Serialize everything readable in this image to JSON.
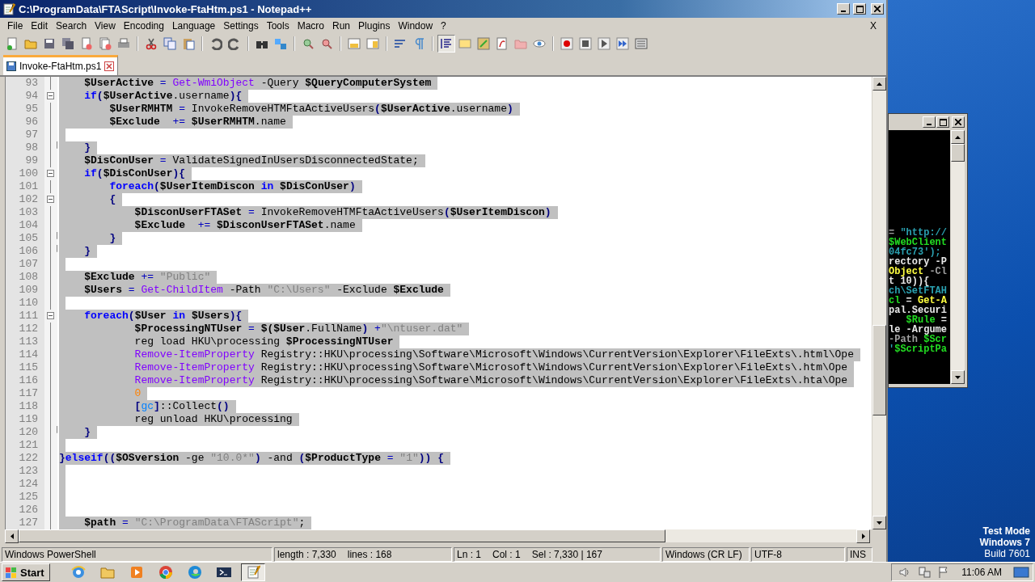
{
  "window": {
    "title": "C:\\ProgramData\\FTAScript\\Invoke-FtaHtm.ps1 - Notepad++",
    "menu": [
      "File",
      "Edit",
      "Search",
      "View",
      "Encoding",
      "Language",
      "Settings",
      "Tools",
      "Macro",
      "Run",
      "Plugins",
      "Window",
      "?"
    ],
    "close_document": "X"
  },
  "tabs": [
    {
      "label": "Invoke-FtaHtm.ps1",
      "selected": true
    }
  ],
  "editor": {
    "lines": [
      {
        "number": "93",
        "fold_open": false,
        "fold_close": false,
        "selected": true,
        "tokens": [
          {
            "kind": "var",
            "text": "    $UserActive"
          },
          {
            "kind": "op",
            "text": " = "
          },
          {
            "kind": "cmd",
            "text": "Get-WmiObject"
          },
          {
            "kind": "txt",
            "text": " -Query "
          },
          {
            "kind": "var",
            "text": "$QueryComputerSystem"
          }
        ]
      },
      {
        "number": "94",
        "fold_open": true,
        "fold_close": false,
        "selected": true,
        "tokens": [
          {
            "kind": "kw",
            "text": "    if"
          },
          {
            "kind": "brace",
            "text": "("
          },
          {
            "kind": "var",
            "text": "$UserActive"
          },
          {
            "kind": "txt",
            "text": ".username"
          },
          {
            "kind": "brace",
            "text": "){"
          }
        ]
      },
      {
        "number": "95",
        "fold_open": false,
        "fold_close": false,
        "selected": true,
        "tokens": [
          {
            "kind": "var",
            "text": "        $UserRMHTM"
          },
          {
            "kind": "op",
            "text": " = "
          },
          {
            "kind": "txt",
            "text": "InvokeRemoveHTMFtaActiveUsers"
          },
          {
            "kind": "brace",
            "text": "("
          },
          {
            "kind": "var",
            "text": "$UserActive"
          },
          {
            "kind": "txt",
            "text": ".username"
          },
          {
            "kind": "brace",
            "text": ")"
          }
        ]
      },
      {
        "number": "96",
        "fold_open": false,
        "fold_close": false,
        "selected": true,
        "tokens": [
          {
            "kind": "var",
            "text": "        $Exclude"
          },
          {
            "kind": "op",
            "text": "  += "
          },
          {
            "kind": "var",
            "text": "$UserRMHTM"
          },
          {
            "kind": "txt",
            "text": ".name"
          }
        ]
      },
      {
        "number": "97",
        "fold_open": false,
        "fold_close": false,
        "selected": true
      },
      {
        "number": "98",
        "fold_open": false,
        "fold_close": true,
        "selected": true,
        "tokens": [
          {
            "kind": "brace",
            "text": "    }"
          }
        ]
      },
      {
        "number": "99",
        "fold_open": false,
        "fold_close": false,
        "selected": true,
        "tokens": [
          {
            "kind": "var",
            "text": "    $DisConUser"
          },
          {
            "kind": "op",
            "text": " = "
          },
          {
            "kind": "txt",
            "text": "ValidateSignedInUsersDisconnectedState;"
          }
        ]
      },
      {
        "number": "100",
        "fold_open": true,
        "fold_close": false,
        "selected": true,
        "tokens": [
          {
            "kind": "kw",
            "text": "    if"
          },
          {
            "kind": "brace",
            "text": "("
          },
          {
            "kind": "var",
            "text": "$DisConUser"
          },
          {
            "kind": "brace",
            "text": "){"
          }
        ]
      },
      {
        "number": "101",
        "fold_open": false,
        "fold_close": false,
        "selected": true,
        "tokens": [
          {
            "kind": "kw",
            "text": "        foreach"
          },
          {
            "kind": "brace",
            "text": "("
          },
          {
            "kind": "var",
            "text": "$UserItemDiscon"
          },
          {
            "kind": "kw",
            "text": " in "
          },
          {
            "kind": "var",
            "text": "$DisConUser"
          },
          {
            "kind": "brace",
            "text": ")"
          }
        ]
      },
      {
        "number": "102",
        "fold_open": true,
        "fold_close": false,
        "selected": true,
        "tokens": [
          {
            "kind": "brace",
            "text": "        {"
          }
        ]
      },
      {
        "number": "103",
        "fold_open": false,
        "fold_close": false,
        "selected": true,
        "tokens": [
          {
            "kind": "var",
            "text": "            $DisconUserFTASet"
          },
          {
            "kind": "op",
            "text": " = "
          },
          {
            "kind": "txt",
            "text": "InvokeRemoveHTMFtaActiveUsers"
          },
          {
            "kind": "brace",
            "text": "("
          },
          {
            "kind": "var",
            "text": "$UserItemDiscon"
          },
          {
            "kind": "brace",
            "text": ")"
          }
        ]
      },
      {
        "number": "104",
        "fold_open": false,
        "fold_close": false,
        "selected": true,
        "tokens": [
          {
            "kind": "var",
            "text": "            $Exclude"
          },
          {
            "kind": "op",
            "text": "  += "
          },
          {
            "kind": "var",
            "text": "$DisconUserFTASet"
          },
          {
            "kind": "txt",
            "text": ".name"
          }
        ]
      },
      {
        "number": "105",
        "fold_open": false,
        "fold_close": true,
        "selected": true,
        "tokens": [
          {
            "kind": "brace",
            "text": "        }"
          }
        ]
      },
      {
        "number": "106",
        "fold_open": false,
        "fold_close": true,
        "selected": true,
        "tokens": [
          {
            "kind": "brace",
            "text": "    }"
          }
        ]
      },
      {
        "number": "107",
        "fold_open": false,
        "fold_close": false,
        "selected": true
      },
      {
        "number": "108",
        "fold_open": false,
        "fold_close": false,
        "selected": true,
        "tokens": [
          {
            "kind": "var",
            "text": "    $Exclude"
          },
          {
            "kind": "op",
            "text": " += "
          },
          {
            "kind": "str",
            "text": "\"Public\""
          }
        ]
      },
      {
        "number": "109",
        "fold_open": false,
        "fold_close": false,
        "selected": true,
        "tokens": [
          {
            "kind": "var",
            "text": "    $Users"
          },
          {
            "kind": "op",
            "text": " = "
          },
          {
            "kind": "cmd",
            "text": "Get-ChildItem"
          },
          {
            "kind": "txt",
            "text": " -Path "
          },
          {
            "kind": "str",
            "text": "\"C:\\Users\""
          },
          {
            "kind": "txt",
            "text": " -Exclude "
          },
          {
            "kind": "var",
            "text": "$Exclude"
          }
        ]
      },
      {
        "number": "110",
        "fold_open": false,
        "fold_close": false,
        "selected": true
      },
      {
        "number": "111",
        "fold_open": true,
        "fold_close": false,
        "selected": true,
        "tokens": [
          {
            "kind": "kw",
            "text": "    foreach"
          },
          {
            "kind": "brace",
            "text": "("
          },
          {
            "kind": "var",
            "text": "$User"
          },
          {
            "kind": "kw",
            "text": " in "
          },
          {
            "kind": "var",
            "text": "$Users"
          },
          {
            "kind": "brace",
            "text": "){"
          }
        ]
      },
      {
        "number": "112",
        "fold_open": false,
        "fold_close": false,
        "selected": true,
        "tokens": [
          {
            "kind": "var",
            "text": "            $ProcessingNTUser"
          },
          {
            "kind": "op",
            "text": " = "
          },
          {
            "kind": "var",
            "text": "$("
          },
          {
            "kind": "var",
            "text": "$User"
          },
          {
            "kind": "txt",
            "text": ".FullName"
          },
          {
            "kind": "brace",
            "text": ")"
          },
          {
            "kind": "op",
            "text": " +"
          },
          {
            "kind": "str",
            "text": "\"\\ntuser.dat\""
          }
        ]
      },
      {
        "number": "113",
        "fold_open": false,
        "fold_close": false,
        "selected": true,
        "tokens": [
          {
            "kind": "txt",
            "text": "            reg load HKU\\processing "
          },
          {
            "kind": "var",
            "text": "$ProcessingNTUser"
          }
        ]
      },
      {
        "number": "114",
        "fold_open": false,
        "fold_close": false,
        "selected": true,
        "tokens": [
          {
            "kind": "cmd",
            "text": "            Remove-ItemProperty"
          },
          {
            "kind": "txt",
            "text": " Registry::HKU\\processing\\Software\\Microsoft\\Windows\\CurrentVersion\\Explorer\\FileExts\\.html\\Ope"
          }
        ]
      },
      {
        "number": "115",
        "fold_open": false,
        "fold_close": false,
        "selected": true,
        "tokens": [
          {
            "kind": "cmd",
            "text": "            Remove-ItemProperty"
          },
          {
            "kind": "txt",
            "text": " Registry::HKU\\processing\\Software\\Microsoft\\Windows\\CurrentVersion\\Explorer\\FileExts\\.htm\\Ope"
          }
        ]
      },
      {
        "number": "116",
        "fold_open": false,
        "fold_close": false,
        "selected": true,
        "tokens": [
          {
            "kind": "cmd",
            "text": "            Remove-ItemProperty"
          },
          {
            "kind": "txt",
            "text": " Registry::HKU\\processing\\Software\\Microsoft\\Windows\\CurrentVersion\\Explorer\\FileExts\\.hta\\Ope"
          }
        ]
      },
      {
        "number": "117",
        "fold_open": false,
        "fold_close": false,
        "selected": true,
        "tokens": [
          {
            "kind": "num",
            "text": "            0"
          }
        ]
      },
      {
        "number": "118",
        "fold_open": false,
        "fold_close": false,
        "selected": true,
        "tokens": [
          {
            "kind": "brace",
            "text": "            ["
          },
          {
            "kind": "type",
            "text": "gc"
          },
          {
            "kind": "brace",
            "text": "]"
          },
          {
            "kind": "txt",
            "text": "::Collect"
          },
          {
            "kind": "brace",
            "text": "()"
          }
        ]
      },
      {
        "number": "119",
        "fold_open": false,
        "fold_close": false,
        "selected": true,
        "tokens": [
          {
            "kind": "txt",
            "text": "            reg unload HKU\\processing"
          }
        ]
      },
      {
        "number": "120",
        "fold_open": false,
        "fold_close": true,
        "selected": true,
        "tokens": [
          {
            "kind": "brace",
            "text": "    }"
          }
        ]
      },
      {
        "number": "121",
        "fold_open": false,
        "fold_close": false,
        "selected": true
      },
      {
        "number": "122",
        "fold_open": false,
        "fold_close": false,
        "selected": true,
        "tokens": [
          {
            "kind": "brace",
            "text": "}"
          },
          {
            "kind": "kw",
            "text": "elseif"
          },
          {
            "kind": "brace",
            "text": "(("
          },
          {
            "kind": "var",
            "text": "$OSversion"
          },
          {
            "kind": "txt",
            "text": " -ge "
          },
          {
            "kind": "str",
            "text": "\"10.0*\""
          },
          {
            "kind": "brace",
            "text": ")"
          },
          {
            "kind": "txt",
            "text": " -and "
          },
          {
            "kind": "brace",
            "text": "("
          },
          {
            "kind": "var",
            "text": "$ProductType"
          },
          {
            "kind": "op",
            "text": " = "
          },
          {
            "kind": "str",
            "text": "\"1\""
          },
          {
            "kind": "brace",
            "text": ")) {"
          }
        ]
      },
      {
        "number": "123",
        "fold_open": false,
        "fold_close": false,
        "selected": true
      },
      {
        "number": "124",
        "fold_open": false,
        "fold_close": false,
        "selected": true
      },
      {
        "number": "125",
        "fold_open": false,
        "fold_close": false,
        "selected": true
      },
      {
        "number": "126",
        "fold_open": false,
        "fold_close": false,
        "selected": true
      },
      {
        "number": "127",
        "fold_open": false,
        "fold_close": false,
        "selected": true,
        "tokens": [
          {
            "kind": "var",
            "text": "    $path"
          },
          {
            "kind": "op",
            "text": " = "
          },
          {
            "kind": "str",
            "text": "\"C:\\ProgramData\\FTAScript\""
          },
          {
            "kind": "txt",
            "text": ";"
          }
        ]
      }
    ]
  },
  "status_bar": [
    {
      "items": [
        "Windows PowerShell"
      ]
    },
    {
      "items": [
        "length : 7,330",
        "lines : 168"
      ]
    },
    {
      "items": [
        "Ln : 1",
        "Col : 1",
        "Sel : 7,330 | 167"
      ]
    },
    {
      "items": [
        "Windows (CR LF)"
      ]
    },
    {
      "items": [
        "UTF-8"
      ]
    },
    {
      "items": [
        "INS"
      ]
    }
  ],
  "console": {
    "lines": [
      {
        "tokens": [
          {
            "kind": "op",
            "text": "= "
          },
          {
            "kind": "str",
            "text": "\"http://"
          }
        ]
      },
      {
        "tokens": [
          {
            "kind": "var",
            "text": "$WebClient"
          }
        ]
      },
      {
        "tokens": [
          {
            "kind": "str",
            "text": "04fc73');"
          }
        ]
      },
      {
        "tokens": [
          {
            "kind": "txt",
            "text": "rectory -P"
          }
        ]
      },
      {
        "tokens": [
          {
            "kind": "cmd",
            "text": "Object"
          },
          {
            "kind": "op",
            "text": " -Cl"
          }
        ]
      },
      {
        "tokens": [
          {
            "kind": "txt",
            "text": "t 10)){"
          }
        ]
      },
      {
        "tokens": [
          {
            "kind": "str",
            "text": "ch\\SetFTAH"
          }
        ]
      },
      {
        "tokens": [
          {
            "kind": "var",
            "text": "cl"
          },
          {
            "kind": "txt",
            "text": " = "
          },
          {
            "kind": "cmd",
            "text": "Get-A"
          }
        ]
      },
      {
        "tokens": [
          {
            "kind": "txt",
            "text": "pal.Securi"
          }
        ]
      },
      {
        "tokens": [
          {
            "kind": "var",
            "text": "   $Rule"
          },
          {
            "kind": "txt",
            "text": " ="
          }
        ]
      },
      {
        "tokens": [
          {
            "kind": "txt",
            "text": "le -Argume"
          }
        ]
      },
      {
        "tokens": [
          {
            "kind": "op",
            "text": "-Path "
          },
          {
            "kind": "var",
            "text": "$Scr"
          }
        ]
      },
      {
        "tokens": [
          {
            "kind": "str",
            "text": "'"
          },
          {
            "kind": "var",
            "text": "$ScriptPa"
          }
        ]
      }
    ]
  },
  "desktop": {
    "notice": [
      "Test Mode",
      "Windows 7",
      "Build 7601"
    ]
  },
  "taskbar": {
    "start": "Start",
    "apps": [
      {
        "kind": "ie",
        "selected": false
      },
      {
        "kind": "explorer",
        "selected": false
      },
      {
        "kind": "media",
        "selected": false
      },
      {
        "kind": "chrome",
        "selected": false
      },
      {
        "kind": "edge",
        "selected": false
      },
      {
        "kind": "powershell",
        "selected": false
      },
      {
        "kind": "notepad",
        "selected": true
      }
    ],
    "clock": "11:06 AM"
  }
}
